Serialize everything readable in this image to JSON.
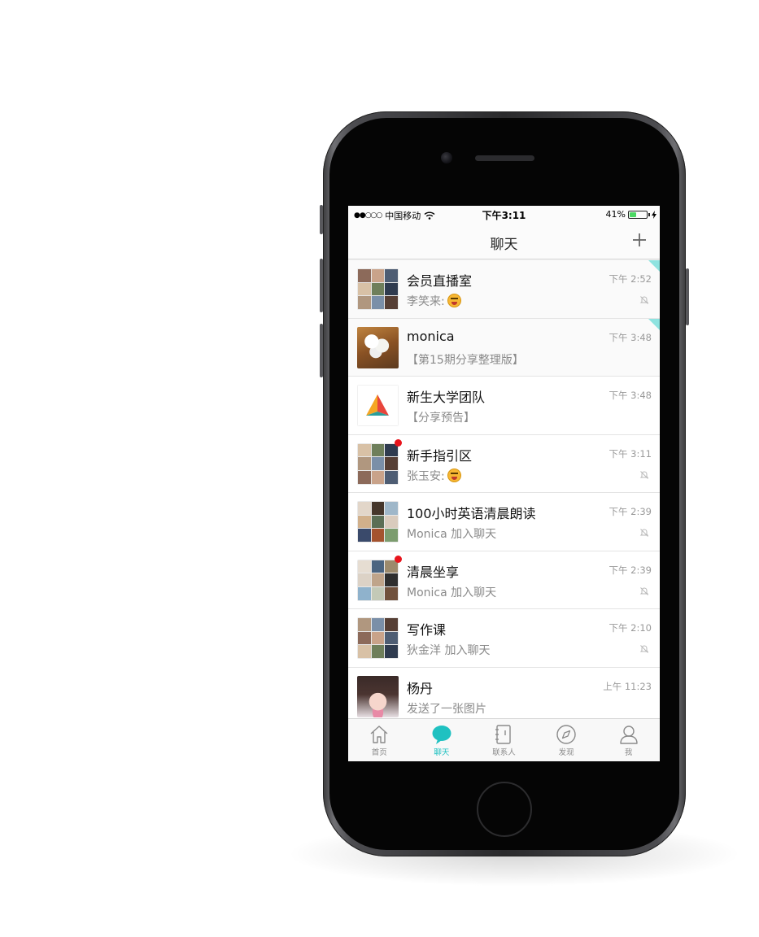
{
  "status_bar": {
    "signal": "●●○○○",
    "carrier": "中国移动",
    "time": "下午3:11",
    "battery_percent": "41%",
    "battery_level": 0.41
  },
  "nav": {
    "title": "聊天",
    "add_icon": "plus-icon"
  },
  "chats": [
    {
      "name": "会员直播室",
      "preview": "李笑来:",
      "preview_emoji": "squinting-tongue-emoji",
      "time": "下午 2:52",
      "muted": true,
      "pinned": true,
      "unread": false,
      "avatar": "group"
    },
    {
      "name": "monica",
      "preview": "【第15期分享整理版】",
      "time": "下午 3:48",
      "muted": false,
      "pinned": true,
      "unread": false,
      "avatar": "food-photo"
    },
    {
      "name": "新生大学团队",
      "preview": "【分享预告】",
      "time": "下午 3:48",
      "muted": false,
      "pinned": false,
      "unread": false,
      "avatar": "triangle-logo"
    },
    {
      "name": "新手指引区",
      "preview": "张玉安:",
      "preview_emoji": "squinting-tongue-emoji",
      "time": "下午 3:11",
      "muted": true,
      "pinned": false,
      "unread": true,
      "avatar": "group"
    },
    {
      "name": "100小时英语清晨朗读",
      "preview": "Monica 加入聊天",
      "time": "下午 2:39",
      "muted": true,
      "pinned": false,
      "unread": false,
      "avatar": "group"
    },
    {
      "name": "清晨坐享",
      "preview": "Monica 加入聊天",
      "time": "下午 2:39",
      "muted": true,
      "pinned": false,
      "unread": true,
      "avatar": "group"
    },
    {
      "name": "写作课",
      "preview": "狄金洋 加入聊天",
      "time": "下午 2:10",
      "muted": true,
      "pinned": false,
      "unread": false,
      "avatar": "group"
    },
    {
      "name": "杨丹",
      "preview": "发送了一张图片",
      "time": "上午 11:23",
      "muted": false,
      "pinned": false,
      "unread": false,
      "avatar": "portrait"
    }
  ],
  "tabs": [
    {
      "label": "首页",
      "icon": "home-icon",
      "active": false
    },
    {
      "label": "聊天",
      "icon": "chat-bubble-icon",
      "active": true
    },
    {
      "label": "联系人",
      "icon": "contacts-book-icon",
      "active": false
    },
    {
      "label": "发现",
      "icon": "compass-icon",
      "active": false
    },
    {
      "label": "我",
      "icon": "person-icon",
      "active": false
    }
  ],
  "colors": {
    "accent": "#1fc1c1",
    "unread": "#e8141c",
    "pin": "#8ee3e0"
  }
}
